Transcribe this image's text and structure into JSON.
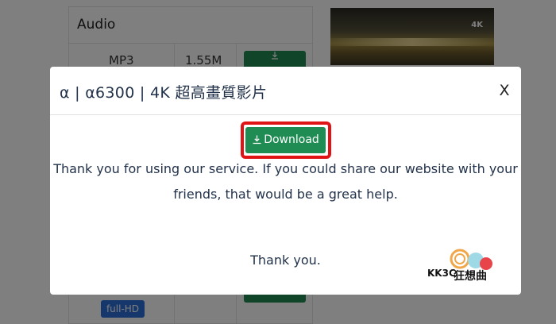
{
  "background": {
    "section_title": "Audio",
    "row": {
      "format": "MP3",
      "size": "1.55M"
    },
    "badge": "full-HD",
    "video_tag": "4K"
  },
  "modal": {
    "title": "α | α6300 | 4K 超高畫質影片",
    "close_label": "X",
    "download_label": "Download",
    "message_line1": "Thank you for using our service. If you could share our website with your",
    "message_line2": "friends, that would be a great help.",
    "thanks": "Thank you."
  },
  "watermark": {
    "text": "KK3C狂想曲"
  },
  "colors": {
    "accent_green": "#1f8c53",
    "highlight_red": "#e01414",
    "badge_blue": "#2b6fd6",
    "text_navy": "#22324a"
  }
}
